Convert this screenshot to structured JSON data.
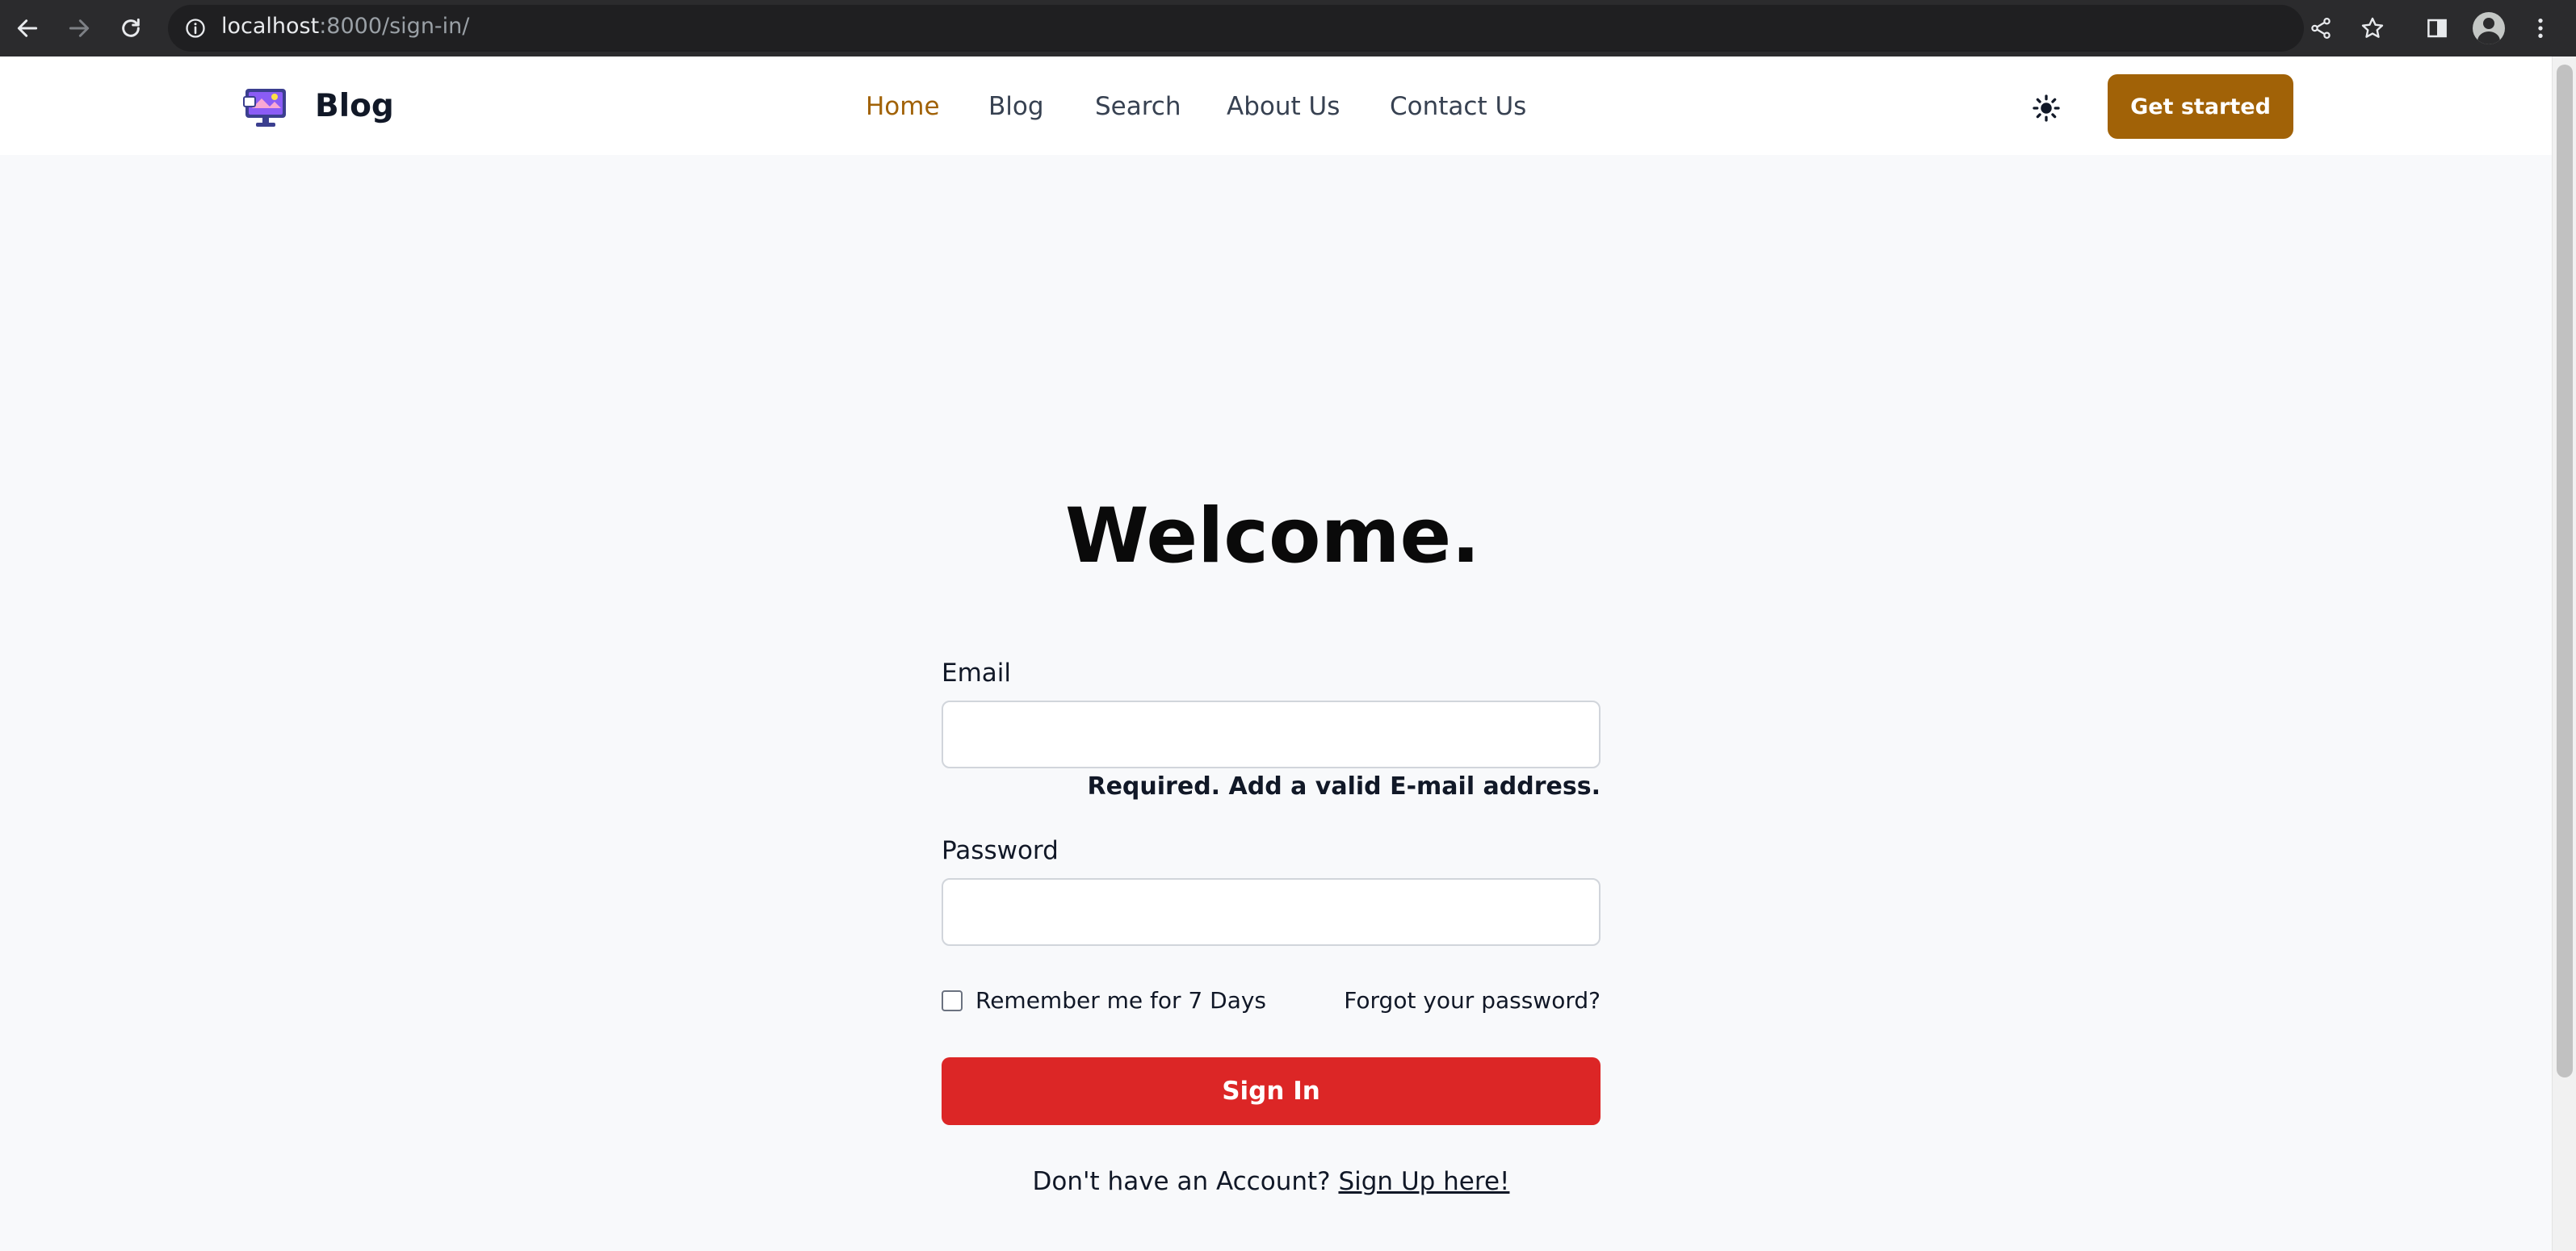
{
  "browser": {
    "url_host": "localhost",
    "url_rest": ":8000/sign-in/",
    "icons": {
      "back": "arrow-left-icon",
      "forward": "arrow-right-icon",
      "reload": "reload-icon",
      "site_info": "info-icon",
      "share": "share-icon",
      "bookmark": "star-icon",
      "side_panel": "side-panel-icon",
      "profile": "profile-avatar-icon",
      "menu": "kebab-menu-icon"
    }
  },
  "header": {
    "brand": "Blog",
    "logo_icon": "monitor-logo-icon",
    "nav": [
      {
        "label": "Home",
        "active": true
      },
      {
        "label": "Blog",
        "active": false
      },
      {
        "label": "Search",
        "active": false
      },
      {
        "label": "About Us",
        "active": false
      },
      {
        "label": "Contact Us",
        "active": false
      }
    ],
    "theme_icon": "sun-icon",
    "cta_label": "Get started"
  },
  "form": {
    "title": "Welcome.",
    "email_label": "Email",
    "email_value": "",
    "email_helper": "Required. Add a valid E-mail address.",
    "password_label": "Password",
    "password_value": "",
    "remember_label": "Remember me for 7 Days",
    "remember_checked": false,
    "forgot_label": "Forgot your password?",
    "submit_label": "Sign In",
    "signup_prompt": "Don't have an Account?",
    "signup_link": "Sign Up here!"
  },
  "colors": {
    "accent": "#a16207",
    "submit": "#dc2626",
    "page_bg": "#f8f9fb",
    "chrome_bg": "#2b2b2d"
  }
}
